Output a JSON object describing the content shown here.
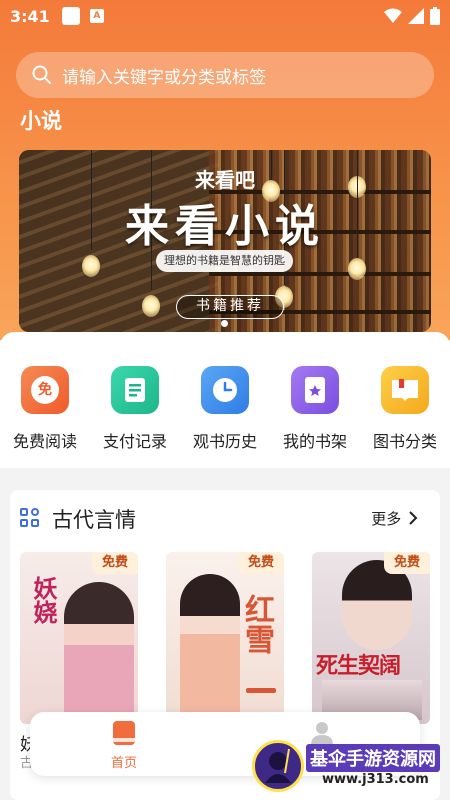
{
  "status_bar": {
    "time": "3:41"
  },
  "search": {
    "placeholder": "请输入关键字或分类或标签"
  },
  "section_title": "小说",
  "banner": {
    "small_title": "来看吧",
    "big_title": "来看小说",
    "tagline": "理想的书籍是智慧的钥匙",
    "button": "书籍推荐"
  },
  "shortcuts": [
    {
      "label": "免费阅读",
      "icon": "free-read-icon",
      "glyph": "免",
      "color": "#f26d3d"
    },
    {
      "label": "支付记录",
      "icon": "payment-record-icon",
      "glyph": "",
      "color": "#26c59b"
    },
    {
      "label": "观书历史",
      "icon": "history-clock-icon",
      "glyph": "",
      "color": "#3d8ef0"
    },
    {
      "label": "我的书架",
      "icon": "bookshelf-icon",
      "glyph": "",
      "color": "#8b5fe6"
    },
    {
      "label": "图书分类",
      "icon": "category-book-icon",
      "glyph": "",
      "color": "#f7b72c"
    }
  ],
  "category": {
    "title": "古代言情",
    "more": "更多",
    "books": [
      {
        "badge": "免费",
        "cover_text": "妖娆",
        "cover_bg": "#f4e3e0",
        "title_color": "#c0235b"
      },
      {
        "badge": "免费",
        "cover_text": "红雪",
        "cover_bg": "#f7ece6",
        "title_color": "#d95634"
      },
      {
        "badge": "免费",
        "cover_text": "死生契阔",
        "cover_bg": "#e9e0e4",
        "title_color": "#c81e2c"
      }
    ],
    "first_book_name_partial": "妖",
    "first_book_sub_partial": "古"
  },
  "tabbar": {
    "items": [
      {
        "label": "首页",
        "active": true,
        "icon": "home-book-icon"
      },
      {
        "label": "",
        "active": false,
        "icon": "user-icon"
      }
    ],
    "active_color": "#f26d3d"
  },
  "watermark": {
    "title": "基伞手游资源网",
    "url": "www.j313.com"
  }
}
